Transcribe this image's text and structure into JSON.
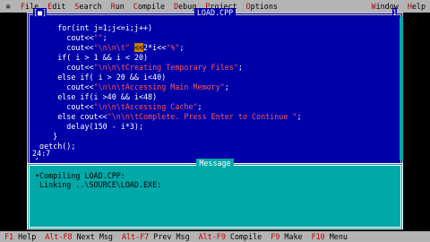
{
  "menu": {
    "system": "≡",
    "items": [
      {
        "hot": "F",
        "rest": "ile"
      },
      {
        "hot": "E",
        "rest": "dit"
      },
      {
        "hot": "S",
        "rest": "earch"
      },
      {
        "hot": "R",
        "rest": "un"
      },
      {
        "hot": "C",
        "rest": "ompile"
      },
      {
        "hot": "D",
        "rest": "ebug"
      },
      {
        "hot": "P",
        "rest": "roject"
      },
      {
        "hot": "O",
        "rest": "ptions"
      }
    ],
    "right": [
      {
        "hot": "W",
        "rest": "indow"
      },
      {
        "hot": "H",
        "rest": "elp"
      }
    ]
  },
  "editor": {
    "title": "LOAD.CPP",
    "close": "[■]",
    "window_number": "1",
    "cursor_pos": "24:7",
    "lines": [
      {
        "parts": [
          {
            "t": "     for(int j=1;j<=i;j++)"
          }
        ]
      },
      {
        "parts": [
          {
            "t": "       cout<<"
          },
          {
            "t": "\"\"",
            "c": "str"
          },
          {
            "t": ";"
          }
        ]
      },
      {
        "parts": [
          {
            "t": "       cout<<"
          },
          {
            "t": "\"\\n\\n\\t\" ",
            "c": "str"
          },
          {
            "t": "<<",
            "c": "hl"
          },
          {
            "t": "2*i<<"
          },
          {
            "t": "\"%\"",
            "c": "str"
          },
          {
            "t": ";"
          }
        ]
      },
      {
        "parts": [
          {
            "t": "     if( i > 1 && i < 20)"
          }
        ]
      },
      {
        "parts": [
          {
            "t": "       cout<<"
          },
          {
            "t": "\"\\n\\n\\tCreating Temporary Files\"",
            "c": "str"
          },
          {
            "t": ";"
          }
        ]
      },
      {
        "parts": [
          {
            "t": "     else if( i > 20 && i<40)"
          }
        ]
      },
      {
        "parts": [
          {
            "t": "       cout<<"
          },
          {
            "t": "\"\\n\\n\\tAccessing Main Memory\"",
            "c": "str"
          },
          {
            "t": ";"
          }
        ]
      },
      {
        "parts": [
          {
            "t": "     else if(i >40 && i<48)"
          }
        ]
      },
      {
        "parts": [
          {
            "t": "       cout<<"
          },
          {
            "t": "\"\\n\\n\\tAccessing Cache\"",
            "c": "str"
          },
          {
            "t": ";"
          }
        ]
      },
      {
        "parts": [
          {
            "t": "     else cout<<"
          },
          {
            "t": "\"\\n\\n\\tComplete. Press Enter to Continue \"",
            "c": "str"
          },
          {
            "t": ";"
          }
        ]
      },
      {
        "parts": [
          {
            "t": "       delay(150 - i*3);"
          }
        ]
      },
      {
        "parts": [
          {
            "t": "    }"
          }
        ]
      },
      {
        "parts": [
          {
            "t": " getch();"
          }
        ]
      },
      {
        "parts": [
          {
            "t": "}"
          }
        ]
      }
    ]
  },
  "message": {
    "title": "Message",
    "lines": [
      "•Compiling LOAD.CPP:",
      " Linking ..\\SOURCE\\LOAD.EXE:"
    ]
  },
  "fkeys": [
    {
      "key": "F1",
      "label": "Help"
    },
    {
      "key": "Alt-F8",
      "label": "Next Msg"
    },
    {
      "key": "Alt-F7",
      "label": "Prev Msg"
    },
    {
      "key": "Alt-F9",
      "label": "Compile"
    },
    {
      "key": "F9",
      "label": "Make"
    },
    {
      "key": "F10",
      "label": "Menu"
    }
  ]
}
